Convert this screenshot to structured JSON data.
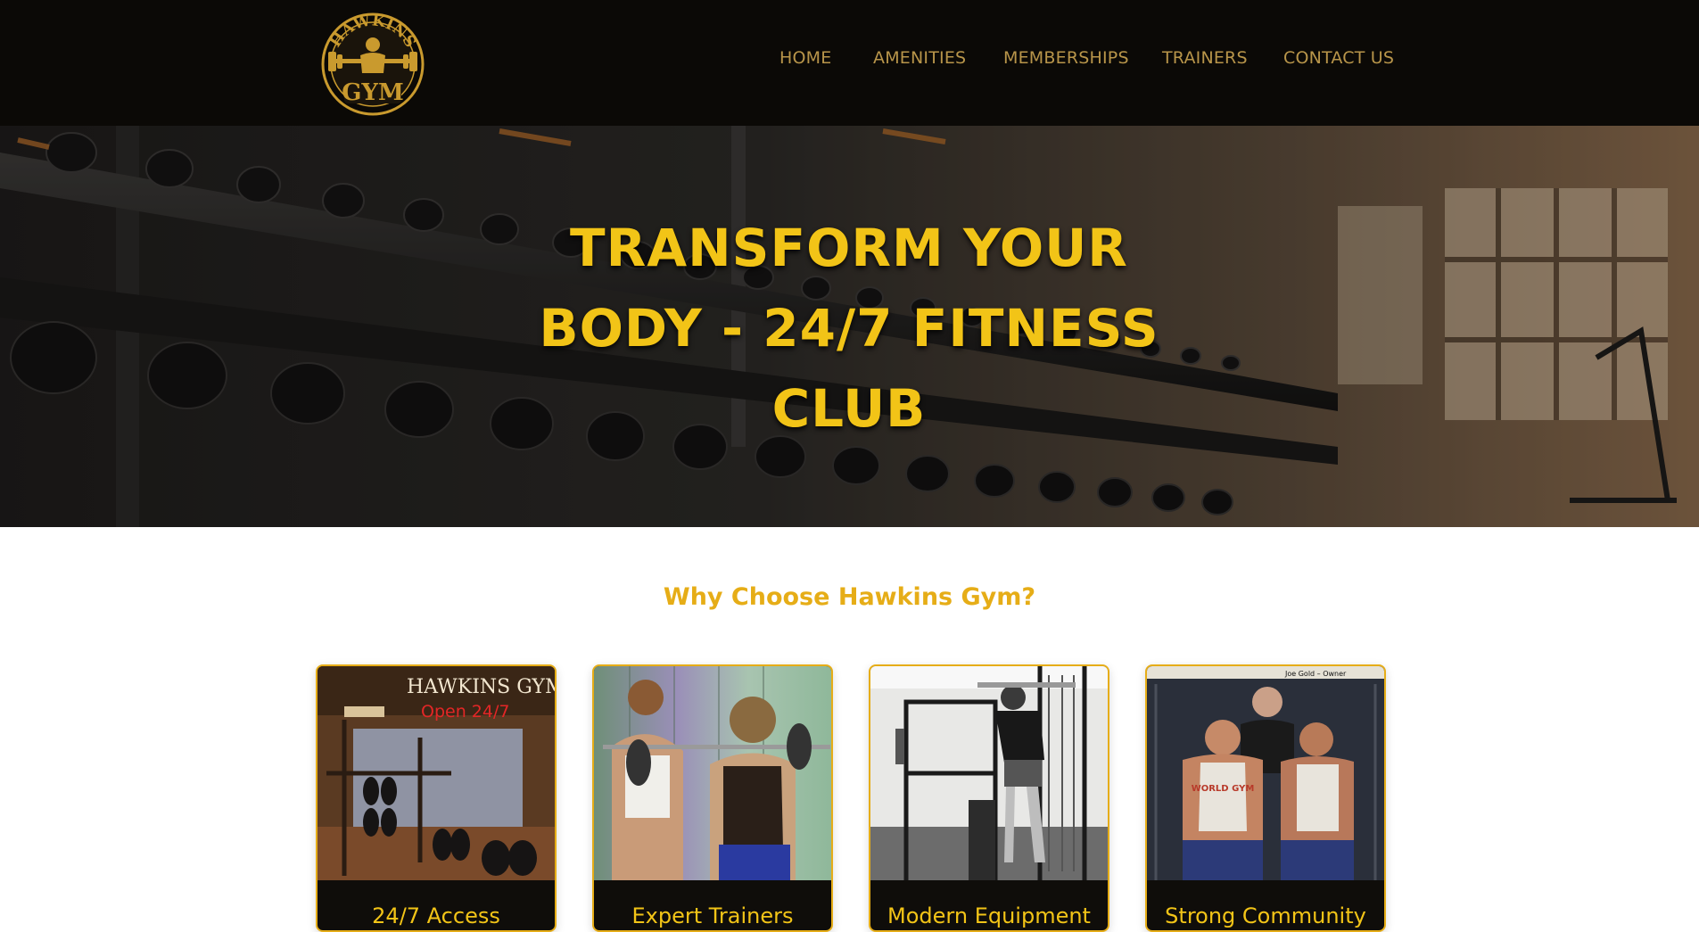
{
  "brand": {
    "logo_text_top": "HAWKINS",
    "logo_text_bottom": "GYM",
    "accent": "#f2c417",
    "nav_color": "#b8954a"
  },
  "nav": {
    "items": [
      {
        "label": "HOME"
      },
      {
        "label": "AMENITIES"
      },
      {
        "label": "MEMBERSHIPS"
      },
      {
        "label": "TRAINERS"
      },
      {
        "label": "CONTACT US"
      }
    ]
  },
  "hero": {
    "title_lines": [
      "TRANSFORM YOUR",
      "BODY - 24/7 FITNESS",
      "CLUB"
    ]
  },
  "features": {
    "heading": "Why Choose Hawkins Gym?",
    "cards": [
      {
        "title": "24/7 Access",
        "sign_text": "HAWKINS GYM",
        "sign_subtext": "Open 24/7"
      },
      {
        "title": "Expert Trainers"
      },
      {
        "title": "Modern Equipment"
      },
      {
        "title": "Strong Community",
        "caption": "Joe Gold – Owner",
        "shirt_text": "WORLD GYM"
      }
    ]
  }
}
